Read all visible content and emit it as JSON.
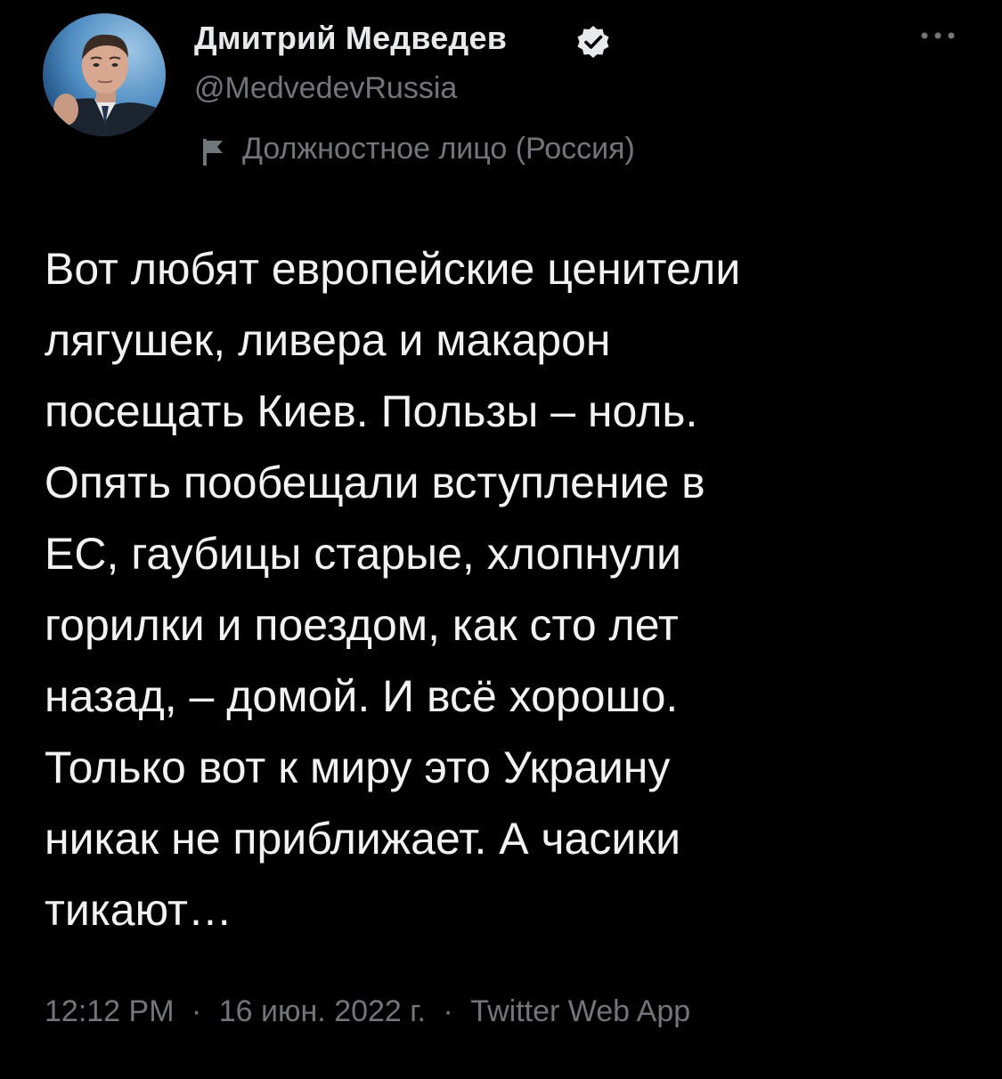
{
  "tweet": {
    "author": {
      "name": "Дмитрий Медведев",
      "handle": "@MedvedevRussia",
      "verified": true,
      "label": "Должностное лицо (Россия)"
    },
    "text": "Вот любят европейские ценители\nлягушек, ливера и макарон\nпосещать Киев. Пользы – ноль.\nОпять пообещали вступление в\nЕС, гаубицы старые, хлопнули\nгорилки и поездом, как сто лет\nназад, – домой. И всё хорошо.\nТолько вот к миру это Украину\nникак не приближает. А часики\nтикают…",
    "meta": {
      "time": "12:12 PM",
      "separator": "·",
      "date": "16 июн. 2022 г.",
      "source": "Twitter Web App"
    }
  },
  "icons": {
    "verified": "verified-badge-icon",
    "more": "more-dots-icon",
    "label": "government-label-icon"
  },
  "colors": {
    "background": "#000000",
    "primary_text": "#e7e9ea",
    "secondary_text": "#71767b"
  }
}
